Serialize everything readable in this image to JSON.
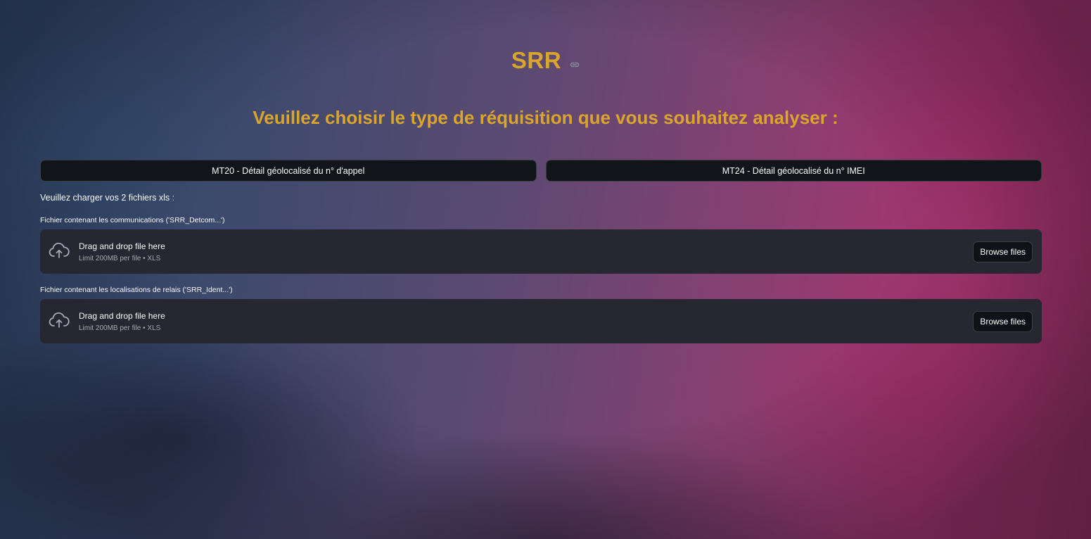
{
  "header": {
    "title": "SRR",
    "subtitle": "Veuillez choisir le type de réquisition que vous souhaitez analyser :"
  },
  "requisition_buttons": [
    {
      "label": "MT20 - Détail géolocalisé du n° d'appel"
    },
    {
      "label": "MT24 - Détail géolocalisé du n° IMEI"
    }
  ],
  "upload_section": {
    "intro": "Veuillez charger vos 2 fichiers xls :",
    "uploaders": [
      {
        "label": "Fichier contenant les communications ('SRR_Detcom...')",
        "drop_text": "Drag and drop file here",
        "limit_text": "Limit 200MB per file • XLS",
        "button_label": "Browse files"
      },
      {
        "label": "Fichier contenant les localisations de relais ('SRR_Ident...')",
        "drop_text": "Drag and drop file here",
        "limit_text": "Limit 200MB per file • XLS",
        "button_label": "Browse files"
      }
    ]
  },
  "icons": {
    "title_anchor": "link-icon",
    "upload": "cloud-upload-icon"
  },
  "colors": {
    "accent_gold": "#d9a52c",
    "dropzone_bg": "#262730",
    "button_bg": "#111418"
  }
}
